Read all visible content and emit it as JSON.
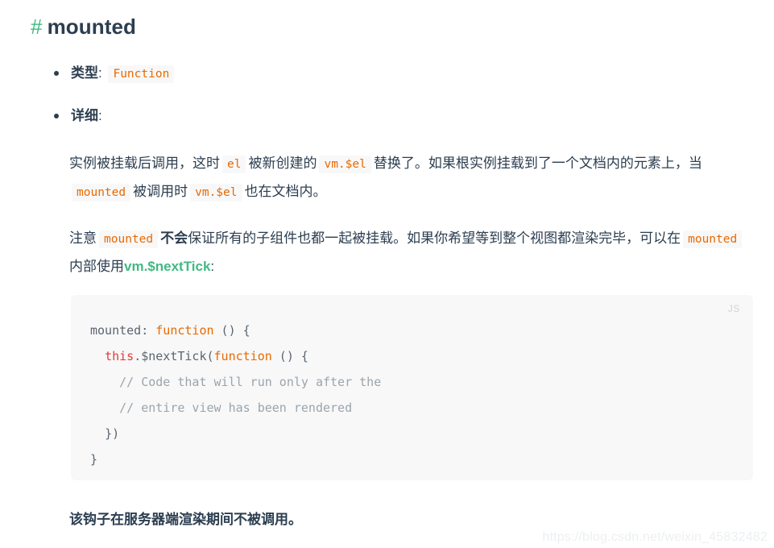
{
  "heading": {
    "anchor": "#",
    "title": "mounted"
  },
  "bullets": [
    {
      "label": "类型",
      "colon": ":",
      "code": "Function"
    },
    {
      "label": "详细",
      "colon": ":"
    }
  ],
  "detail": {
    "paragraph1": {
      "t1": "实例被挂载后调用，这时",
      "c1": "el",
      "t2": "被新创建的",
      "c2": "vm.$el",
      "t3": "替换了。如果根实例挂载到了一个文档内的元素上，当",
      "c3": "mounted",
      "t4": "被调用时",
      "c4": "vm.$el",
      "t5": "也在文档内。"
    },
    "paragraph2": {
      "t1": "注意",
      "c1": "mounted",
      "bold": "不会",
      "t2": "保证所有的子组件也都一起被挂载。如果你希望等到整个视图都渲染完毕，可以在",
      "c2": "mounted",
      "t3": "内部使用",
      "link": "vm.$nextTick",
      "t4": ":"
    }
  },
  "code_block": {
    "lang_label": "JS",
    "lines": [
      "mounted: function () {",
      "  this.$nextTick(function () {",
      "    // Code that will run only after the",
      "    // entire view has been rendered",
      "  })",
      "}"
    ],
    "tokens": {
      "l1_a": "mounted: ",
      "l1_b": "function",
      "l1_c": " () {",
      "l2_a": "this",
      "l2_b": ".$nextTick(",
      "l2_c": "function",
      "l2_d": " () {",
      "l3": "// Code that will run only after the",
      "l4": "// entire view has been rendered",
      "l5": "})",
      "l6": "}"
    }
  },
  "closing_note": "该钩子在服务器端渲染期间不被调用。",
  "watermark": "https://blog.csdn.net/weixin_45832482",
  "colors": {
    "accent_green": "#42b983",
    "text": "#2c3e50",
    "inline_code_text": "#e96900",
    "inline_code_bg": "#f8f8f8",
    "code_block_bg": "#f8f8f8",
    "comment": "#9aa4ae",
    "keyword": "#e96900",
    "this_keyword": "#e4393c",
    "watermark": "#eceff1"
  }
}
